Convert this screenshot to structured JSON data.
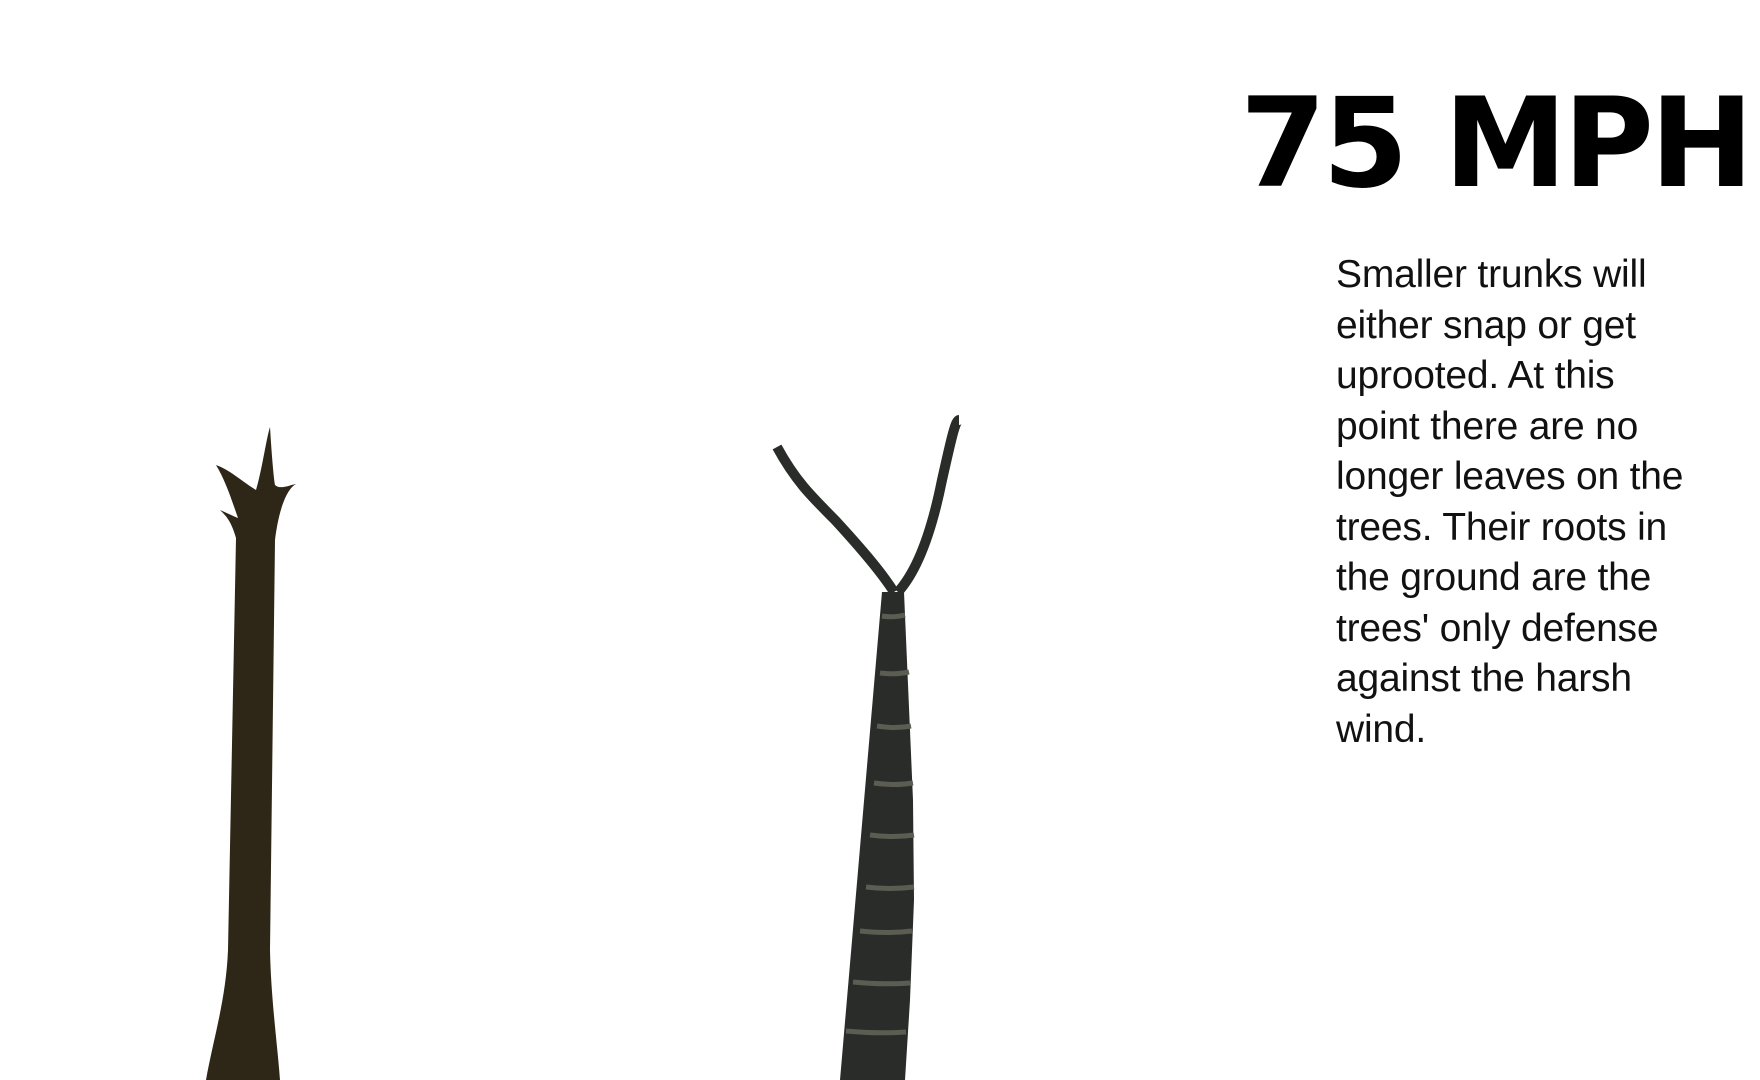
{
  "headline": "75 MPH",
  "description": "Smaller trunks will\neither snap or get\nuprooted. At this\npoint there are no\nlonger leaves on the\ntrees.  Their roots in\nthe ground are the\ntrees' only defense\nagainst the harsh\nwind.",
  "colors": {
    "background": "#ffffff",
    "snapped_trunk": "#2e2718",
    "bare_trunk": "#2a2c29",
    "bark_rings": "#5b5c52"
  },
  "icons": [
    "snapped-tree-icon",
    "bare-tree-icon"
  ]
}
